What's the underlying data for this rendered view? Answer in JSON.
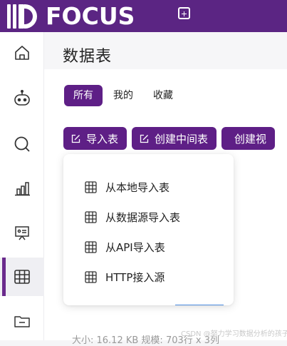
{
  "header": {
    "logo_text": "FOCUS",
    "new_tab_icon": "plus-square-icon"
  },
  "sidebar": {
    "items": [
      {
        "icon": "home-icon"
      },
      {
        "icon": "robot-icon"
      },
      {
        "icon": "search-icon"
      },
      {
        "icon": "bar-chart-icon"
      },
      {
        "icon": "presentation-board-icon"
      },
      {
        "icon": "table-grid-icon",
        "active": true
      },
      {
        "icon": "folder-icon"
      }
    ]
  },
  "page": {
    "title": "数据表",
    "tabs": [
      {
        "label": "所有",
        "active": true
      },
      {
        "label": "我的",
        "active": false
      },
      {
        "label": "收藏",
        "active": false
      }
    ],
    "actions": {
      "import_table": "导入表",
      "create_intermediate_table": "创建中间表",
      "create_view": "创建视"
    }
  },
  "dropdown": {
    "items": [
      {
        "label": "从本地导入表"
      },
      {
        "label": "从数据源导入表"
      },
      {
        "label": "从API导入表"
      },
      {
        "label": "HTTP接入源"
      }
    ]
  },
  "footer": {
    "info": "大小:  16.12 KB    规模:  703行 x 3列"
  },
  "watermark": "CSDN @努力学习数据分析的孩子",
  "colors": {
    "brand": "#5b2583",
    "button": "#5e1f86"
  }
}
